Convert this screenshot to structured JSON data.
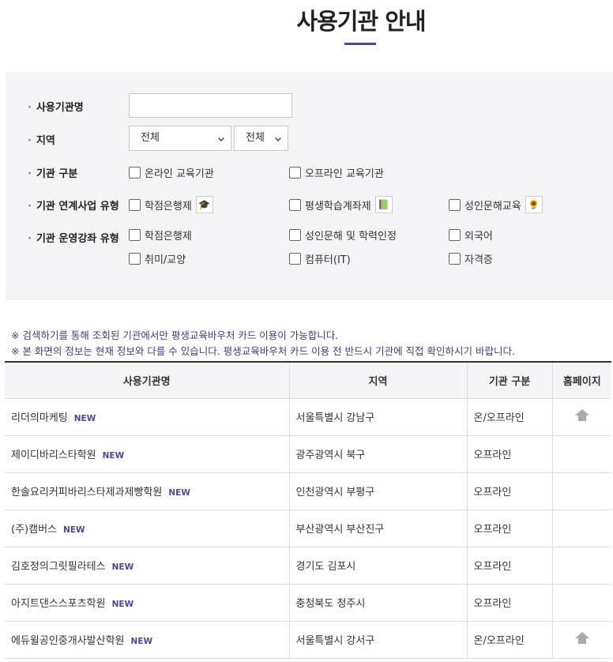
{
  "title": "사용기관 안내",
  "search": {
    "name_label": "사용기관명",
    "name_value": "",
    "region_label": "지역",
    "region_select1": "전체",
    "region_select2": "전체",
    "type_label": "기관 구분",
    "type_options": [
      "온라인 교육기관",
      "오프라인 교육기관"
    ],
    "project_label": "기관 연계사업 유형",
    "project_options": [
      "학점은행제",
      "평생학습계좌제",
      "성인문해교육"
    ],
    "course_label": "기관 운영강좌 유형",
    "course_options": [
      "학점은행제",
      "성인문해 및 학력인정",
      "외국어",
      "취미/교양",
      "컴퓨터(IT)",
      "자격증"
    ]
  },
  "notices": [
    "※ 검색하기를 통해 조회된 기관에서만 평생교육바우처 카드 이용이 가능합니다.",
    "※ 본 화면의 정보는 현재 정보와 다를 수 있습니다. 평생교육바우처 카드 이용 전 반드시 기관에 직접 확인하시기 바랍니다."
  ],
  "table": {
    "headers": [
      "사용기관명",
      "지역",
      "기관 구분",
      "홈페이지"
    ],
    "new_badge": "NEW",
    "rows": [
      {
        "name": "리더의마케팅",
        "region": "서울특별시 강남구",
        "type": "온/오프라인",
        "home": true
      },
      {
        "name": "제이디바리스타학원",
        "region": "광주광역시 북구",
        "type": "오프라인",
        "home": false
      },
      {
        "name": "한솔요리커피바리스타제과제빵학원",
        "region": "인천광역시 부평구",
        "type": "오프라인",
        "home": false
      },
      {
        "name": "(주)캠버스",
        "region": "부산광역시 부산진구",
        "type": "오프라인",
        "home": false
      },
      {
        "name": "김호정의그릿필라테스",
        "region": "경기도 김포시",
        "type": "오프라인",
        "home": false
      },
      {
        "name": "아지트댄스스포츠학원",
        "region": "충청북도 청주시",
        "type": "오프라인",
        "home": false
      },
      {
        "name": "에듀윌공인중개사발산학원",
        "region": "서울특별시 강서구",
        "type": "온/오프라인",
        "home": true
      }
    ]
  }
}
